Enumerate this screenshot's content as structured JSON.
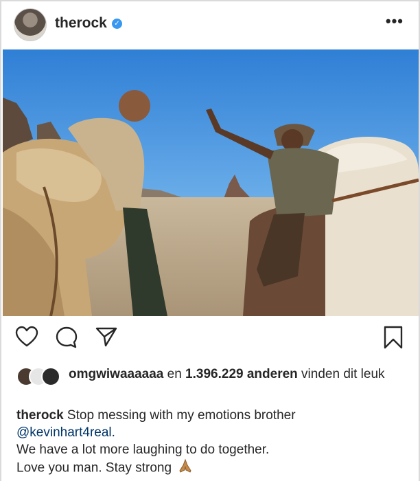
{
  "post": {
    "username": "therock",
    "verified_mark": "✓",
    "more_icon": "•••"
  },
  "likes": {
    "liker": "omgwiwaaaaaa",
    "connector": "en",
    "count_text": "1.396.229 anderen",
    "suffix": "vinden dit leuk"
  },
  "caption": {
    "author": "therock",
    "line1": "Stop messing with my emotions brother",
    "mention": "@kevinhart4real.",
    "line2": "We have a lot more laughing to do together.",
    "line3": "Love you man. Stay strong"
  },
  "icons": {
    "like": "heart-icon",
    "comment": "comment-icon",
    "share": "share-icon",
    "save": "bookmark-icon",
    "caption_emoji": "praying-hands-icon"
  },
  "colors": {
    "verified": "#3897f0",
    "mention": "#003569",
    "sky": "#3f8fdc"
  }
}
